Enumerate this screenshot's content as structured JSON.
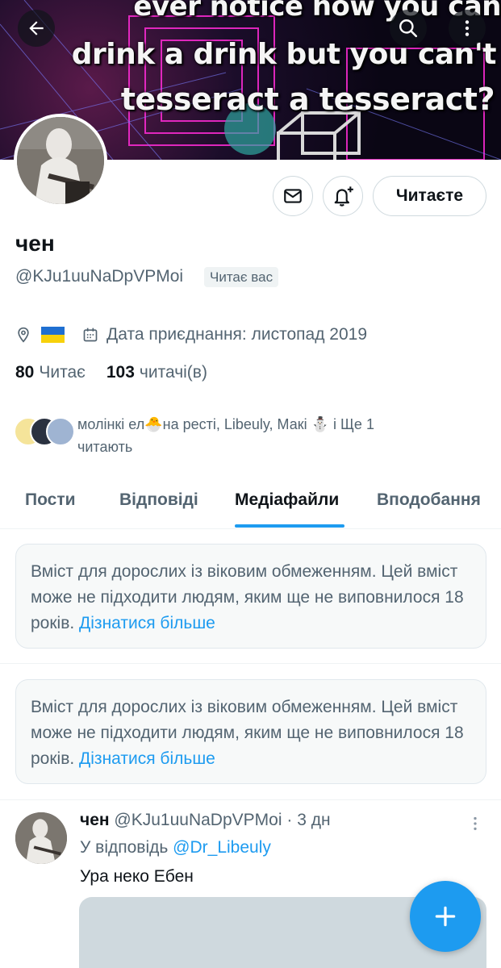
{
  "banner": {
    "line1": "ever notice how you can",
    "line2": "drink a drink but you can't",
    "line3": "tesseract a tesseract?"
  },
  "icons": {
    "back": "arrow-left-icon",
    "search": "search-icon",
    "more": "more-vertical-icon",
    "message": "mail-icon",
    "notifications": "bell-plus-icon",
    "location": "location-pin-icon",
    "calendar": "calendar-icon",
    "compose": "plus-icon"
  },
  "profile": {
    "name": "чен",
    "handle": "@KJu1uuNaDpVPMoi",
    "follows_you": "Читає вас",
    "follow_button": "Читаєте",
    "location_flag": "🇺🇦",
    "joined": "Дата приєднання: листопад 2019",
    "following_count": "80",
    "following_label": "Читає",
    "followers_count": "103",
    "followers_label": "читачі(в)",
    "mutuals_line1": "молінкі ел🐣на ресті, Libeuly, Макі ⛄ і Ще 1",
    "mutuals_line2": "читають"
  },
  "tabs": [
    {
      "label": "Пости",
      "active": false
    },
    {
      "label": "Відповіді",
      "active": false
    },
    {
      "label": "Медіафайли",
      "active": true
    },
    {
      "label": "Вподобання",
      "active": false
    }
  ],
  "sensitive_notice": {
    "text": "Вміст для дорослих із віковим обмеженням. Цей вміст може не підходити людям, яким ще не виповнилося 18 років.",
    "link": "Дізнатися більше"
  },
  "tweet": {
    "name": "чен",
    "handle": "@KJu1uuNaDpVPMoi",
    "separator": "·",
    "time": "3 дн",
    "reply_prefix": "У відповідь",
    "reply_to": "@Dr_Libeuly",
    "text": "Ура неко Ебен"
  },
  "colors": {
    "accent": "#1d9bf0",
    "text_primary": "#0f1419",
    "text_secondary": "#536471"
  }
}
